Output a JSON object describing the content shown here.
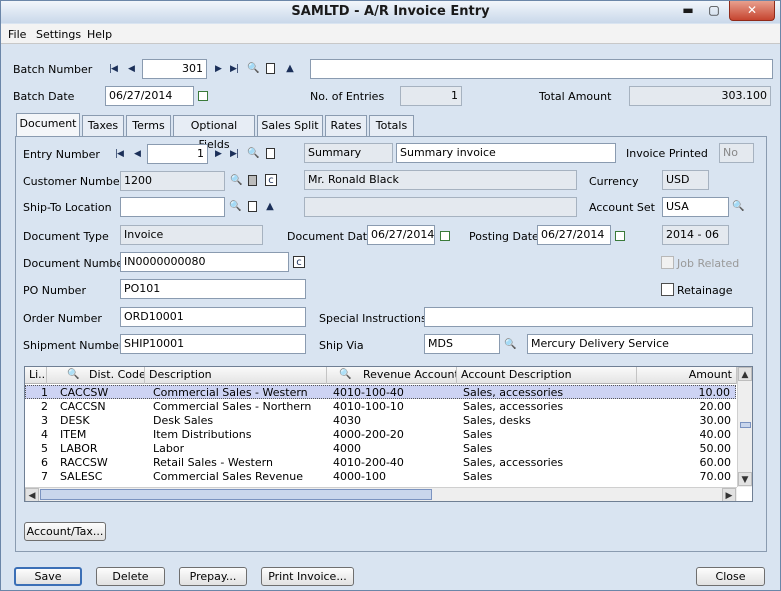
{
  "window": {
    "title": "SAMLTD - A/R Invoice Entry",
    "minimize": "▬",
    "maximize": "▢",
    "close": "✕"
  },
  "menu": [
    "File",
    "Settings",
    "Help"
  ],
  "batch": {
    "number_label": "Batch Number",
    "number": "301",
    "description": "",
    "date_label": "Batch Date",
    "date": "06/27/2014",
    "entries_label": "No. of Entries",
    "entries": "1",
    "total_label": "Total Amount",
    "total": "303.100"
  },
  "tabs": [
    "Document",
    "Taxes",
    "Terms",
    "Optional Fields",
    "Sales Split",
    "Rates",
    "Totals"
  ],
  "document": {
    "entry_number_label": "Entry Number",
    "entry_number": "1",
    "summary_type": "Summary",
    "summary_desc": "Summary invoice",
    "invoice_printed_label": "Invoice Printed",
    "invoice_printed": "No",
    "customer_number_label": "Customer Number",
    "customer_number": "1200",
    "customer_name": "Mr. Ronald Black",
    "currency_label": "Currency",
    "currency": "USD",
    "ship_to_label": "Ship-To Location",
    "ship_to": "",
    "ship_to_desc": "",
    "account_set_label": "Account Set",
    "account_set": "USA",
    "document_type_label": "Document Type",
    "document_type": "Invoice",
    "document_date_label": "Document Date",
    "document_date": "06/27/2014",
    "posting_date_label": "Posting Date",
    "posting_date": "06/27/2014",
    "period": "2014 - 06",
    "document_number_label": "Document Number",
    "document_number": "IN0000000080",
    "job_related_label": "Job Related",
    "po_number_label": "PO Number",
    "po_number": "PO101",
    "retainage_label": "Retainage",
    "order_number_label": "Order Number",
    "order_number": "ORD10001",
    "special_instructions_label": "Special Instructions",
    "special_instructions": "",
    "shipment_number_label": "Shipment Number",
    "shipment_number": "SHIP10001",
    "ship_via_label": "Ship Via",
    "ship_via": "MDS",
    "ship_via_desc": "Mercury Delivery Service"
  },
  "grid": {
    "headers": [
      "Li...",
      "Dist. Code",
      "Description",
      "Revenue Account",
      "Account Description",
      "Amount"
    ],
    "rows": [
      {
        "line": "1",
        "code": "CACCSW",
        "desc": "Commercial Sales - Western",
        "account": "4010-100-40",
        "acct_desc": "Sales, accessories",
        "amount": "10.00"
      },
      {
        "line": "2",
        "code": "CACCSN",
        "desc": "Commercial Sales - Northern",
        "account": "4010-100-10",
        "acct_desc": "Sales, accessories",
        "amount": "20.00"
      },
      {
        "line": "3",
        "code": "DESK",
        "desc": "Desk Sales",
        "account": "4030",
        "acct_desc": "Sales, desks",
        "amount": "30.00"
      },
      {
        "line": "4",
        "code": "ITEM",
        "desc": "Item Distributions",
        "account": "4000-200-20",
        "acct_desc": "Sales",
        "amount": "40.00"
      },
      {
        "line": "5",
        "code": "LABOR",
        "desc": "Labor",
        "account": "4000",
        "acct_desc": "Sales",
        "amount": "50.00"
      },
      {
        "line": "6",
        "code": "RACCSW",
        "desc": "Retail Sales - Western",
        "account": "4010-200-40",
        "acct_desc": "Sales, accessories",
        "amount": "60.00"
      },
      {
        "line": "7",
        "code": "SALESC",
        "desc": "Commercial Sales Revenue",
        "account": "4000-100",
        "acct_desc": "Sales",
        "amount": "70.00"
      }
    ]
  },
  "buttons": {
    "account_tax": "Account/Tax...",
    "save": "Save",
    "delete": "Delete",
    "prepay": "Prepay...",
    "print_invoice": "Print Invoice...",
    "close": "Close"
  }
}
